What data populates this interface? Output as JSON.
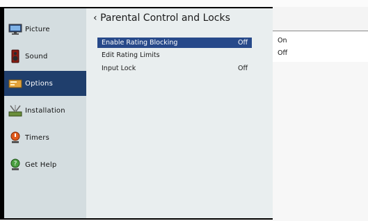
{
  "sidebar": {
    "items": [
      {
        "label": "Picture",
        "icon": "monitor-icon",
        "active": false
      },
      {
        "label": "Sound",
        "icon": "speaker-icon",
        "active": false
      },
      {
        "label": "Options",
        "icon": "options-icon",
        "active": true
      },
      {
        "label": "Installation",
        "icon": "satellite-dish-icon",
        "active": false
      },
      {
        "label": "Timers",
        "icon": "timer-icon",
        "active": false
      },
      {
        "label": "Get Help",
        "icon": "help-icon",
        "active": false
      }
    ]
  },
  "main": {
    "back_glyph": "‹",
    "title": "Parental Control and Locks",
    "rows": [
      {
        "label": "Enable Rating Blocking",
        "value": "Off",
        "selected": true
      },
      {
        "label": "Edit Rating Limits",
        "value": "",
        "selected": false
      },
      {
        "label": "Input Lock",
        "value": "Off",
        "selected": false
      }
    ]
  },
  "popup": {
    "options": [
      "On",
      "Off"
    ]
  },
  "colors": {
    "highlight": "#27498a",
    "sidebar_active": "#1f3e6c",
    "sidebar_bg": "#d4dde0",
    "main_bg": "#e9eeef"
  }
}
